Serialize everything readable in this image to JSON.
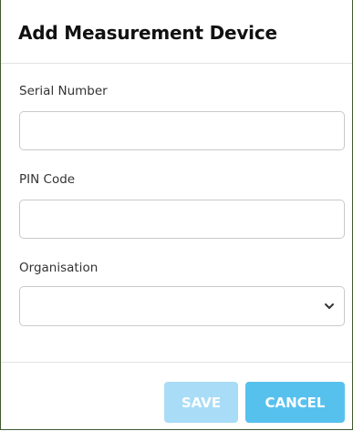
{
  "dialog": {
    "title": "Add Measurement Device"
  },
  "form": {
    "serial_number": {
      "label": "Serial Number",
      "value": ""
    },
    "pin_code": {
      "label": "PIN Code",
      "value": ""
    },
    "organisation": {
      "label": "Organisation",
      "selected": "",
      "icon": "chevron-down-icon"
    }
  },
  "footer": {
    "save_label": "SAVE",
    "cancel_label": "CANCEL",
    "save_color": "#a9dcf6",
    "cancel_color": "#57c1ee",
    "save_disabled": true
  }
}
